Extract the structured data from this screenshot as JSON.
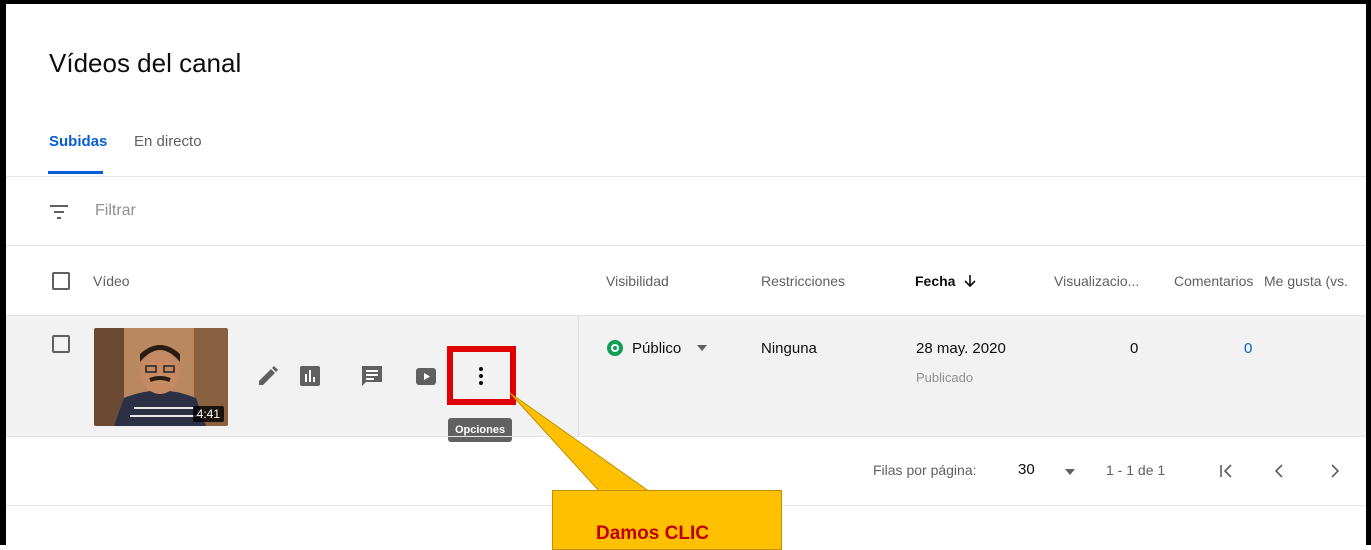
{
  "page": {
    "title": "Vídeos del canal"
  },
  "tabs": [
    {
      "label": "Subidas",
      "active": true
    },
    {
      "label": "En directo",
      "active": false
    }
  ],
  "filter": {
    "placeholder": "Filtrar",
    "icon": "filter-icon"
  },
  "table": {
    "headers": {
      "video": "Vídeo",
      "visibility": "Visibilidad",
      "restrictions": "Restricciones",
      "date": "Fecha",
      "date_sort_icon": "arrow-down-icon",
      "views": "Visualizacio...",
      "comments": "Comentarios",
      "likes": "Me gusta (vs."
    },
    "rows": [
      {
        "duration": "4:41",
        "actions": [
          "edit-icon",
          "analytics-icon",
          "comments-icon",
          "youtube-icon",
          "more-vert-icon"
        ],
        "options_tooltip": "Opciones",
        "visibility": "Público",
        "restrictions": "Ninguna",
        "date": "28 may. 2020",
        "status": "Publicado",
        "views": "0",
        "comments": "0"
      }
    ]
  },
  "pagination": {
    "rows_per_page_label": "Filas por página:",
    "rows_per_page_value": "30",
    "range": "1 - 1 de 1"
  },
  "annotation": {
    "callout_text": "Damos CLIC"
  },
  "colors": {
    "accent": "#065fd4",
    "public_green": "#0f9d58",
    "highlight_red": "#e00000",
    "callout_yellow": "#ffc000",
    "callout_text": "#c00000"
  }
}
